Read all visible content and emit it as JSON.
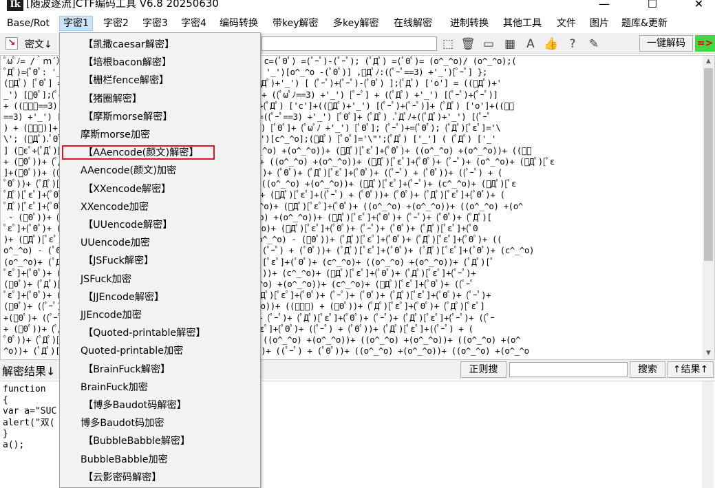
{
  "window": {
    "app_icon_text": "Ik",
    "title": "[随波逐流]CTF编码工具 V6.8  20250630",
    "minimize": "—",
    "maximize": "☐",
    "close": "✕"
  },
  "menubar": {
    "items": [
      "Base/Rot",
      "字密1",
      "字密2",
      "字密3",
      "字密4",
      "编码转换",
      "带key解密",
      "多key解密",
      "在线解密",
      "进制转换",
      "其他工具",
      "文件",
      "图片",
      "题库&更新"
    ]
  },
  "toolbar": {
    "mode_label": "密文↓",
    "decode_button": "一键解码",
    "arrow": "=>"
  },
  "cipher": {
    "lines": [
      "ﾟωﾟﾉ= /｀ｍ´）ﾉ ~┻━┻   //*´∇｀*/ ['_'];  o=(ﾟｰﾟ)  =_=3; c=(ﾟΘﾟ) =(ﾟｰﾟ)-(ﾟｰﾟ); (ﾟДﾟ) =(ﾟΘﾟ)= (o^_^o)/ (o^_^o);(",
      "ﾟДﾟ)={ﾟΘﾟ: '_' ,ﾟωﾟﾉ : ((ﾟωﾟﾉ==3) +'_') [ﾟΘﾟ] ,ﾟｰﾟﾉ :(ﾟωﾟﾉ+ '_')[o^_^o -(ﾟΘﾟ)] ,ﾟДﾟﾉ:((ﾟｰﾟ==3) +'_')[ﾟｰﾟ] };",
      "(ﾟДﾟ) [ﾟΘﾟ] =((ﾟωﾟﾉ==3) +'_') [c^_^o];(ﾟДﾟ) ['c'] = ((ﾟДﾟ)+'_') [ (ﾟｰﾟ)+(ﾟｰﾟ)-(ﾟΘﾟ) ];(ﾟДﾟ) ['o'] = ((ﾟДﾟ)+'",
      "_') [ﾟΘﾟ];(ﾟoﾟ)=(ﾟДﾟ) ['c']+(ﾟДﾟ) ['o']+(ﾟωﾟﾉ +'_')[ﾟΘﾟ]+ ((ﾟωﾟﾉ==3) +'_') [ﾟｰﾟ] + ((ﾟДﾟ) +'_') [(ﾟｰﾟ)+(ﾟｰﾟ)]",
      "+ ((ﾟｰﾟ==3) +'_') [ﾟΘﾟ]+((ﾟｰﾟ==3) +'_') [(ﾟｰﾟ) - (ﾟΘﾟ)]+(ﾟДﾟ) ['c']+((ﾟДﾟ)+'_') [(ﾟｰﾟ)+(ﾟｰﾟ)]+ (ﾟДﾟ) ['o']+((ﾟｰ",
      "==3) +'_') [ﾟΘﾟ];(ﾟДﾟ) ['_'] =(o^_^o) [ﾟoﾟ] [ﾟoﾟ];(ﾟεﾟ)=((ﾟｰﾟ==3) +'_') [ﾟΘﾟ]+ (ﾟДﾟ) .ﾟДﾟﾉ+((ﾟДﾟ)+'_') [(ﾟｰﾟ",
      ") + (ﾟｰﾟ)]+((ﾟｰﾟ==3) +'_') [o^_^o -ﾟΘﾟ]+((ﾟｰﾟ==3) +'_') [ﾟΘﾟ]+ (ﾟωﾟﾉ +'_') [ﾟΘﾟ]; (ﾟｰﾟ)+=(ﾟΘﾟ); (ﾟДﾟ)[ﾟεﾟ]='\\",
      "\\'; (ﾟДﾟ).ﾟΘﾟﾉ=(ﾟДﾟ+ ﾟｰﾟ)[o^_^o -(ﾟΘﾟ)];(oﾟｰﾟo)=(ﾟωﾟﾉ +'_')[c^_^o];(ﾟДﾟ) [ﾟoﾟ]='\\\"';(ﾟДﾟ) ['_'] ( (ﾟДﾟ) ['_'",
      "] (ﾟεﾟ+(ﾟДﾟ)[ﾟoﾟ]+ (ﾟДﾟ)[ﾟεﾟ]+(ﾟΘﾟ)+ ((ﾟｰﾟ) + (ﾟｰﾟ))+ ((o^_^o) +(o^_^o))+ (ﾟДﾟ)[ﾟεﾟ]+(ﾟΘﾟ)+ ((o^_^o) +(o^_^o))+ ((ﾟｰ",
      "+ (ﾟΘﾟ))+ (ﾟДﾟ)[ﾟεﾟ]+((ﾟｰﾟ) + (ﾟΘﾟ))+ ((o^_^o) +(o^_^o))+ ((o^_^o) +(o^_^o))+ (ﾟДﾟ)[ﾟεﾟ]+(ﾟΘﾟ)+ (ﾟｰﾟ)+ (o^_^o)+ (ﾟДﾟ)[ﾟε",
      "]+(ﾟΘﾟ))+ ((ﾟｰﾟ) + (ﾟΘﾟ))+ (ﾟДﾟ)[ﾟεﾟ]+((ﾟｰﾟ) + (ﾟΘﾟ))+ (ﾟΘﾟ)+ (ﾟΘﾟ)+ (ﾟДﾟ)[ﾟεﾟ]+(ﾟΘﾟ)+ ((ﾟｰﾟ) + (ﾟΘﾟ))+ ((ﾟｰﾟ) + (",
      "ﾟΘﾟ))+ (ﾟДﾟ)[ﾟεﾟ]+(ﾟΘﾟ)+ ((ﾟｰﾟ) + (ﾟΘﾟ))+ ((ﾟｰﾟ) + (ﾟΘﾟ))+ ((o^_^o) +(o^_^o))+ (ﾟДﾟ)[ﾟεﾟ]+(ﾟｰﾟ)+ (c^_^o)+ (ﾟДﾟ)[ﾟε",
      "ﾟДﾟ)[ﾟεﾟ]+(ﾟΘﾟ)+ ((ﾟｰﾟ) + (ﾟΘﾟ))+ ((ﾟｰﾟ) + (ﾟΘﾟ))+ (c^_^o)+ (ﾟДﾟ)[ﾟεﾟ]+((ﾟｰﾟ) + (ﾟΘﾟ))+ (ﾟΘﾟ)+ (ﾟДﾟ)[ﾟεﾟ]+(ﾟΘﾟ)+ (",
      "ﾟДﾟ)[ﾟεﾟ]+(ﾟΘﾟ)+ ((ﾟｰﾟ) + (ﾟΘﾟ))+ ((ﾟｰﾟ) + (o^_^o))+ (o^_^o)+ (ﾟДﾟ)[ﾟεﾟ]+(ﾟΘﾟ)+ ((o^_^o) +(o^_^o))+ ((o^_^o) +(o^",
      " - (ﾟΘﾟ))+ (ﾟДﾟ)[ﾟεﾟ]+(ﾟΘﾟ)+ ((o^_^o) +(o^_^o))+ ((o^_^o) +(o^_^o))+ (ﾟДﾟ)[ﾟεﾟ]+(ﾟΘﾟ)+ (ﾟｰﾟ)+ (ﾟΘﾟ)+ (ﾟДﾟ)[",
      "ﾟεﾟ]+(ﾟΘﾟ)+ ((ﾟｰﾟ) + (ﾟΘﾟ))+ (ﾟΘﾟ)+ (ﾟДﾟ)[ﾟεﾟ]+(ﾟｰﾟ)+ (c^_^o)+ (ﾟДﾟ)[ﾟεﾟ]+(ﾟΘﾟ)+ (ﾟｰﾟ)+ (ﾟΘﾟ)+ (ﾟДﾟ)[ﾟεﾟ]+(ﾟΘ",
      ")+ (ﾟДﾟ)[ﾟεﾟ]+(ﾟΘﾟ)+ ((ﾟｰﾟ) + (ﾟΘﾟ))+ (ﾟДﾟ)[ﾟεﾟ]+(ﾟｰﾟ)+ ((o^_^o) - (ﾟΘﾟ))+ (ﾟДﾟ)[ﾟεﾟ]+(ﾟΘﾟ)+ (ﾟДﾟ)[ﾟεﾟ]+(ﾟΘﾟ)+ ((",
      "o^_^o) - (ﾟΘﾟ))+ (ﾟДﾟ)[ﾟεﾟ]+(ﾟΘﾟ)+ ((o^_^o) - (ﾟΘﾟ))+ ((ﾟｰﾟ) + (ﾟΘﾟ))+ (ﾟДﾟ)[ﾟεﾟ]+(ﾟΘﾟ)+ (ﾟДﾟ)[ﾟεﾟ]+(ﾟΘﾟ)+ (c^_^o)",
      "(o^_^o)+ (ﾟДﾟ)[ﾟεﾟ]+(ﾟΘﾟ)+ ((ﾟｰﾟ) + (ﾟΘﾟ))+ (ﾟｰﾟ)+ (ﾟДﾟ)[ﾟεﾟ]+(ﾟΘﾟ)+ (c^_^o)+ ((o^_^o) +(o^_^o))+ (ﾟДﾟ)[ﾟ",
      "ﾟεﾟ]+(ﾟΘﾟ)+ ((ﾟｰﾟ) + (ﾟΘﾟ))+ (ﾟДﾟ)[ﾟεﾟ]+(ﾟΘﾟ)+ ((ﾟｰﾟ) + (ﾟΘﾟ))+ (c^_^o)+ (ﾟДﾟ)[ﾟεﾟ]+(ﾟΘﾟ)+ (ﾟДﾟ)[ﾟεﾟ]+(ﾟｰﾟ)+",
      "(ﾟΘﾟ)+ (ﾟДﾟ)[ﾟεﾟ]+((ﾟｰﾟ) + (ﾟΘﾟ))+ (ﾟДﾟ)[ﾟεﾟ]+(ﾟΘﾟ)+ ((o^_^o) +(o^_^o))+ (c^_^o)+ (ﾟДﾟ)[ﾟεﾟ]+(ﾟΘﾟ)+ ((ﾟｰﾟ",
      "ﾟεﾟ]+(ﾟΘﾟ)+ ((ﾟｰﾟ) + (ﾟΘﾟ))+ (ﾟДﾟ)[ﾟεﾟ]+(ﾟｰﾟ)+ (c^_^o)+ (ﾟДﾟ)[ﾟεﾟ]+(ﾟΘﾟ)+ (ﾟｰﾟ)+ (ﾟΘﾟ)+ (ﾟДﾟ)[ﾟεﾟ]+(ﾟΘﾟ)+ (ﾟｰﾟ)+",
      "(ﾟΘﾟ)+ ((ﾟｰﾟ) + (ﾟΘﾟ))+ (ﾟДﾟ)[ﾟεﾟ]+(ﾟΘﾟ)+ ((o^_^o) +(o^_^o))+ ((ﾟｰﾟ) + (ﾟΘﾟ))+ (ﾟДﾟ)[ﾟεﾟ]+(ﾟΘﾟ)+ (ﾟДﾟ)[ﾟεﾟ]",
      "+(ﾟΘﾟ)+ ((ﾟｰﾟ) + (ﾟΘﾟ))+ (ﾟДﾟ)[ﾟεﾟ]+(ﾟΘﾟ)+ ((ﾟｰﾟ) + (ﾟΘﾟ))+ (ﾟｰﾟ)+ (ﾟДﾟ)[ﾟεﾟ]+(ﾟΘﾟ)+ (ﾟｰﾟ)+ (ﾟДﾟ)[ﾟεﾟ]+(ﾟｰﾟ)+ ((ﾟｰ",
      "+ (ﾟΘﾟ))+ (ﾟДﾟ)[ﾟεﾟ]+(ﾟΘﾟ)+ ((ﾟｰﾟ) + (ﾟΘﾟ))+ (ﾟｰﾟ)+ (ﾟДﾟ)[ﾟεﾟ]+(ﾟΘﾟ)+ ((ﾟｰﾟ) + (ﾟΘﾟ))+ (ﾟДﾟ)[ﾟεﾟ]+((ﾟｰﾟ) + (",
      "ﾟΘﾟ))+ (ﾟДﾟ)[ﾟεﾟ]+(ﾟΘﾟ)+ ((ﾟｰﾟ) + (ﾟΘﾟ))+ (ﾟДﾟ)[ﾟεﾟ]+(ﾟΘﾟ)+ ((o^_^o) +(o^_^o))+ ((o^_^o) +(o^_^o))+ ((o^_^o) +(o^",
      "^o))+ (ﾟДﾟ)[ﾟεﾟ]+(ﾟΘﾟ)+ ((ﾟｰﾟ) + (ﾟΘﾟ))+ (ﾟДﾟ)[ﾟεﾟ]+(ﾟΘﾟ)+ ((ﾟｰﾟ) + (ﾟΘﾟ))+ ((o^_^o) +(o^_^o))+ ((o^_^o) +(o^_^o"
    ]
  },
  "result_bar": {
    "label": "解密结果↓",
    "regex_button": "正则搜",
    "search_button": "搜索",
    "result_nav_button": "↑结果↑"
  },
  "result": {
    "lines": [
      "function ",
      "{",
      "var a=\"SUC",
      "alert(\"双(",
      "}",
      "a();"
    ]
  },
  "dropdown": {
    "items": [
      {
        "label": "【凯撒caesar解密】",
        "indent": true
      },
      {
        "label": "【培根bacon解密】",
        "indent": true
      },
      {
        "label": "【栅栏fence解密】",
        "indent": true
      },
      {
        "label": "【猪圈解密】",
        "indent": true
      },
      {
        "label": "【摩斯morse解密】",
        "indent": true
      },
      {
        "label": "摩斯morse加密",
        "indent": false
      },
      {
        "label": "【AAencode(颜文)解密】",
        "indent": true,
        "highlighted": true
      },
      {
        "label": "AAencode(颜文)加密",
        "indent": false
      },
      {
        "label": "【XXencode解密】",
        "indent": true
      },
      {
        "label": "XXencode加密",
        "indent": false
      },
      {
        "label": "【UUencode解密】",
        "indent": true
      },
      {
        "label": "UUencode加密",
        "indent": false
      },
      {
        "label": "【JSFuck解密】",
        "indent": true
      },
      {
        "label": "JSFuck加密",
        "indent": false
      },
      {
        "label": "【JJEncode解密】",
        "indent": true
      },
      {
        "label": "JJEncode加密",
        "indent": false
      },
      {
        "label": "【Quoted-printable解密】",
        "indent": true
      },
      {
        "label": "Quoted-printable加密",
        "indent": false
      },
      {
        "label": "【BrainFuck解密】",
        "indent": true
      },
      {
        "label": "BrainFuck加密",
        "indent": false
      },
      {
        "label": "【博多Baudot码解密】",
        "indent": true
      },
      {
        "label": "博多Baudot码加密",
        "indent": false
      },
      {
        "label": "【BubbleBabble解密】",
        "indent": true
      },
      {
        "label": "BubbleBabble加密",
        "indent": false
      },
      {
        "label": "【云影密码解密】",
        "indent": true
      }
    ]
  },
  "colors": {
    "highlight_border": "#e81123",
    "arrow_bg": "#43d843",
    "arrow_fg": "#e00000",
    "menu_active_bg": "#cce4f7"
  }
}
